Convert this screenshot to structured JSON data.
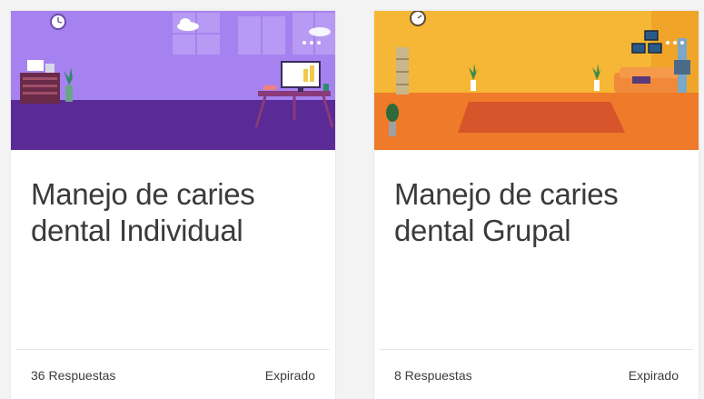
{
  "cards": [
    {
      "title": "Manejo de caries dental Individual",
      "responses": "36 Respuestas",
      "status": "Expirado",
      "theme": {
        "sky": "#a682f0",
        "floor": "#5a2a97",
        "accent": "#f2c94c"
      }
    },
    {
      "title": "Manejo de caries dental Grupal",
      "responses": "8 Respuestas",
      "status": "Expirado",
      "theme": {
        "sky": "#f5b735",
        "floor": "#ee7a2a",
        "accent": "#d8542a"
      }
    }
  ],
  "icons": {
    "clock": "clock-icon",
    "more": "more-options-icon"
  }
}
